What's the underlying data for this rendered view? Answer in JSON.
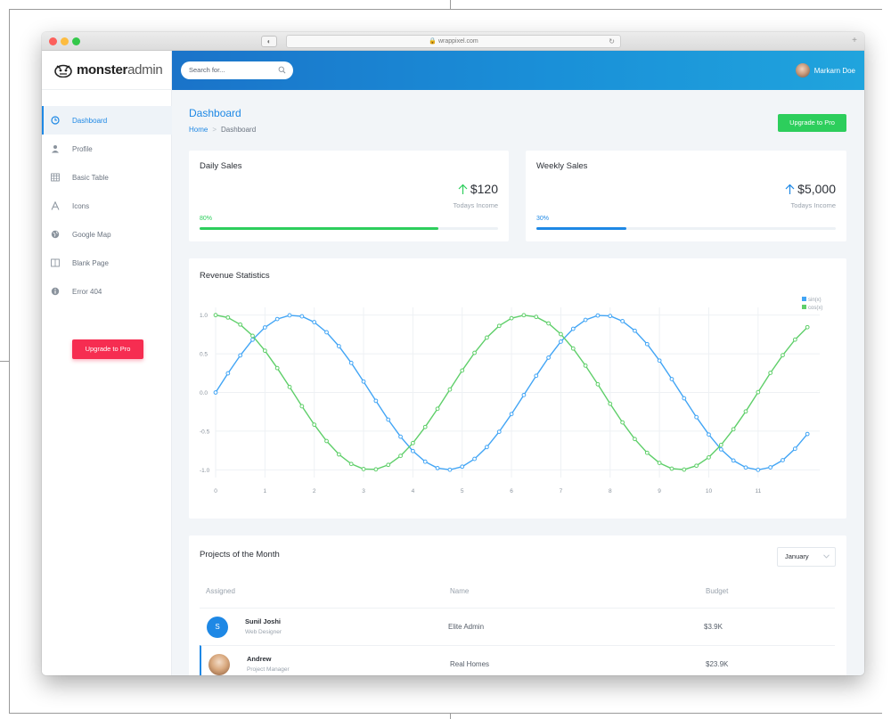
{
  "browser": {
    "url": "🔒 wrappixel.com",
    "traffic_lights": [
      "#fc605c",
      "#fdbc40",
      "#34c84a"
    ]
  },
  "brand": {
    "name_bold": "monster",
    "name_light": "admin",
    "logo_icon": "monster-face-icon"
  },
  "sidebar": {
    "items": [
      {
        "label": "Dashboard",
        "icon": "clock-icon",
        "active": true
      },
      {
        "label": "Profile",
        "icon": "person-icon"
      },
      {
        "label": "Basic Table",
        "icon": "table-icon"
      },
      {
        "label": "Icons",
        "icon": "font-icon"
      },
      {
        "label": "Google Map",
        "icon": "globe-icon"
      },
      {
        "label": "Blank Page",
        "icon": "columns-icon"
      },
      {
        "label": "Error 404",
        "icon": "info-icon"
      }
    ],
    "upgrade_label": "Upgrade to Pro"
  },
  "topbar": {
    "search_placeholder": "Search for...",
    "user_name": "Markarn Doe"
  },
  "header": {
    "title": "Dashboard",
    "breadcrumb_home": "Home",
    "breadcrumb_sep": ">",
    "breadcrumb_current": "Dashboard",
    "upgrade_label": "Upgrade to Pro"
  },
  "cards": {
    "daily": {
      "title": "Daily Sales",
      "amount": "$120",
      "subtitle": "Todays Income",
      "percent_label": "80%",
      "progress": 0.8,
      "color": "#2dce5c",
      "arrow_color": "#2dce5c"
    },
    "weekly": {
      "title": "Weekly Sales",
      "amount": "$5,000",
      "subtitle": "Todays Income",
      "percent_label": "30%",
      "progress": 0.3,
      "color": "#1e88e5",
      "arrow_color": "#1e88e5"
    }
  },
  "revenue": {
    "title": "Revenue Statistics"
  },
  "chart_data": {
    "type": "line",
    "title": "Revenue Statistics",
    "xlabel": "",
    "ylabel": "",
    "x_ticks": [
      "0",
      "1",
      "2",
      "3",
      "4",
      "5",
      "6",
      "7",
      "8",
      "9",
      "10",
      "11"
    ],
    "y_ticks": [
      "1.0",
      "0.5",
      "0.0",
      "-0.5",
      "-1.0"
    ],
    "xlim": [
      0,
      12.25
    ],
    "ylim": [
      -1.1,
      1.1
    ],
    "grid": true,
    "legend": "top-right",
    "series": [
      {
        "name": "sin(x)",
        "color": "#42a5f5",
        "x": [
          0.0,
          0.25,
          0.5,
          0.75,
          1.0,
          1.25,
          1.5,
          1.75,
          2.0,
          2.25,
          2.5,
          2.75,
          3.0,
          3.25,
          3.5,
          3.75,
          4.0,
          4.25,
          4.5,
          4.75,
          5.0,
          5.25,
          5.5,
          5.75,
          6.0,
          6.25,
          6.5,
          6.75,
          7.0,
          7.25,
          7.5,
          7.75,
          8.0,
          8.25,
          8.5,
          8.75,
          9.0,
          9.25,
          9.5,
          9.75,
          10.0,
          10.25,
          10.5,
          10.75,
          11.0,
          11.25,
          11.5,
          11.75,
          12.0
        ],
        "y": [
          0.0,
          0.247,
          0.479,
          0.682,
          0.841,
          0.949,
          0.997,
          0.984,
          0.909,
          0.778,
          0.598,
          0.382,
          0.141,
          -0.108,
          -0.351,
          -0.572,
          -0.757,
          -0.895,
          -0.978,
          -0.999,
          -0.959,
          -0.859,
          -0.706,
          -0.508,
          -0.279,
          -0.033,
          0.215,
          0.45,
          0.657,
          0.823,
          0.938,
          0.995,
          0.989,
          0.922,
          0.798,
          0.625,
          0.412,
          0.173,
          -0.075,
          -0.319,
          -0.544,
          -0.736,
          -0.88,
          -0.97,
          -1.0,
          -0.968,
          -0.875,
          -0.728,
          -0.537
        ]
      },
      {
        "name": "cos(x)",
        "color": "#5fcf6a",
        "x": [
          0.0,
          0.25,
          0.5,
          0.75,
          1.0,
          1.25,
          1.5,
          1.75,
          2.0,
          2.25,
          2.5,
          2.75,
          3.0,
          3.25,
          3.5,
          3.75,
          4.0,
          4.25,
          4.5,
          4.75,
          5.0,
          5.25,
          5.5,
          5.75,
          6.0,
          6.25,
          6.5,
          6.75,
          7.0,
          7.25,
          7.5,
          7.75,
          8.0,
          8.25,
          8.5,
          8.75,
          9.0,
          9.25,
          9.5,
          9.75,
          10.0,
          10.25,
          10.5,
          10.75,
          11.0,
          11.25,
          11.5,
          11.75,
          12.0
        ],
        "y": [
          1.0,
          0.969,
          0.878,
          0.732,
          0.54,
          0.315,
          0.071,
          -0.178,
          -0.416,
          -0.628,
          -0.801,
          -0.924,
          -0.99,
          -0.994,
          -0.936,
          -0.82,
          -0.654,
          -0.446,
          -0.211,
          0.038,
          0.284,
          0.512,
          0.709,
          0.861,
          0.96,
          0.999,
          0.977,
          0.893,
          0.754,
          0.568,
          0.347,
          0.106,
          -0.146,
          -0.387,
          -0.602,
          -0.78,
          -0.911,
          -0.985,
          -0.997,
          -0.947,
          -0.839,
          -0.678,
          -0.476,
          -0.245,
          0.004,
          0.253,
          0.482,
          0.683,
          0.844
        ]
      }
    ]
  },
  "projects": {
    "title": "Projects of the Month",
    "month": "January",
    "columns": [
      "Assigned",
      "Name",
      "Budget"
    ],
    "rows": [
      {
        "initial": "S",
        "name": "Sunil Joshi",
        "role": "Web Designer",
        "project": "Elite Admin",
        "budget": "$3.9K",
        "avatar_color": "#1e88e5"
      },
      {
        "initial": "",
        "name": "Andrew",
        "role": "Project Manager",
        "project": "Real Homes",
        "budget": "$23.9K",
        "avatar_color": "#d6a583"
      }
    ]
  }
}
